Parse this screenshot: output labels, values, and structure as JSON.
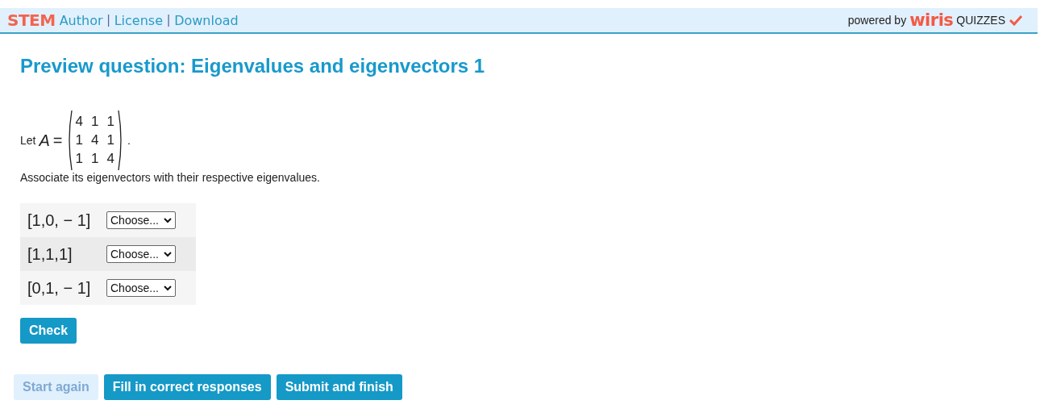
{
  "header": {
    "brand": "STEM",
    "links": [
      "Author",
      "License",
      "Download"
    ],
    "separator": "|",
    "powered_by": "powered by",
    "logo_text": "wiris",
    "product": "QUIZZES"
  },
  "title": "Preview question: Eigenvalues and eigenvectors 1",
  "question": {
    "prefix": "Let",
    "variable": "A",
    "equals": "=",
    "matrix": [
      [
        "4",
        "1",
        "1"
      ],
      [
        "1",
        "4",
        "1"
      ],
      [
        "1",
        "1",
        "4"
      ]
    ],
    "suffix": ".",
    "instruction": "Associate its eigenvectors with their respective eigenvalues."
  },
  "matches": [
    {
      "vector": "[1,0, − 1]",
      "choice": "Choose..."
    },
    {
      "vector": "[1,1,1]",
      "choice": "Choose..."
    },
    {
      "vector": "[0,1, − 1]",
      "choice": "Choose..."
    }
  ],
  "check_button": "Check",
  "actions": [
    {
      "label": "Start again",
      "disabled": true
    },
    {
      "label": "Fill in correct responses",
      "disabled": false
    },
    {
      "label": "Submit and finish",
      "disabled": false
    }
  ]
}
